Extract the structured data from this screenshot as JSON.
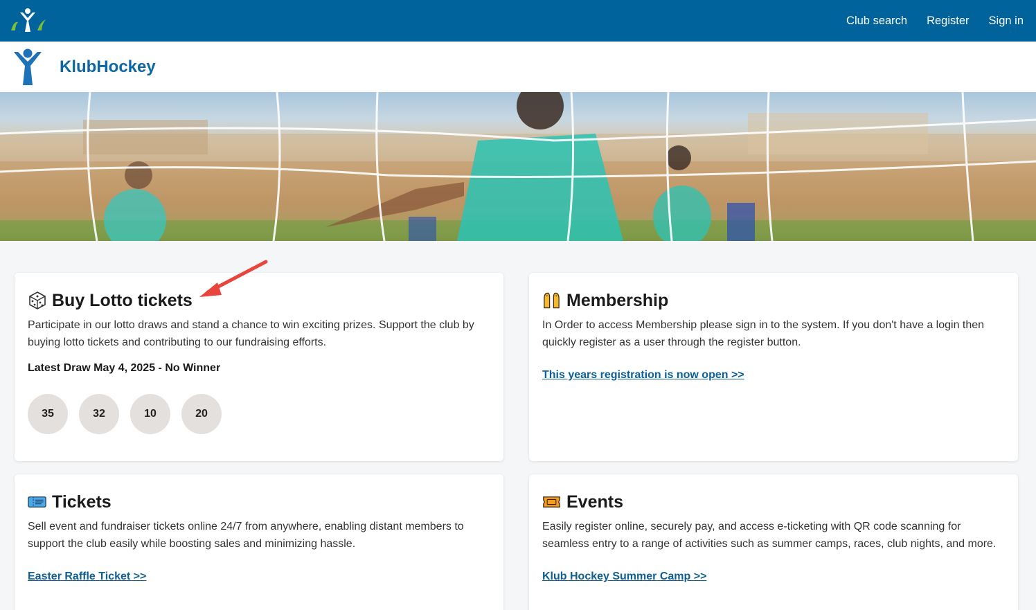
{
  "topbar": {
    "nav": {
      "club_search": "Club search",
      "register": "Register",
      "sign_in": "Sign in"
    },
    "color": "#00639c"
  },
  "club": {
    "name": "KlubHockey",
    "color": "#0d67a0"
  },
  "hero": {
    "icon": "hockey-net-photo"
  },
  "cards": {
    "lotto": {
      "icon": "dice-icon",
      "title": "Buy Lotto tickets",
      "text": "Participate in our lotto draws and stand a chance to win exciting prizes. Support the club by buying lotto tickets and contributing to our fundraising efforts.",
      "latest_draw": "Latest Draw May 4, 2025 - No Winner",
      "numbers": [
        "35",
        "32",
        "10",
        "20"
      ]
    },
    "membership": {
      "icon": "raised-hands-icon",
      "title": "Membership",
      "text": "In Order to access Membership please sign in to the system. If you don't have a login then quickly register as a user through the register button.",
      "link": "This years registration is now open >>"
    },
    "tickets": {
      "icon": "ticket-icon",
      "title": "Tickets",
      "text": "Sell event and fundraiser tickets online 24/7 from anywhere, enabling distant members to support the club easily while boosting sales and minimizing hassle.",
      "link": "Easter Raffle Ticket >>"
    },
    "events": {
      "icon": "admission-ticket-icon",
      "title": "Events",
      "text": "Easily register online, securely pay, and access e-ticketing with QR code scanning for seamless entry to a range of activities such as summer camps, races, club nights, and more.",
      "link": "Klub Hockey Summer Camp >>"
    }
  },
  "annotation": {
    "color": "#e8453c"
  }
}
